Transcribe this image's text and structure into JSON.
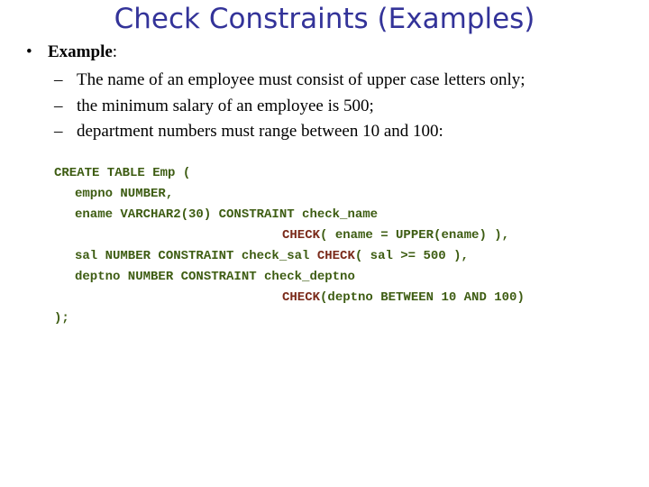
{
  "title": "Check Constraints (Examples)",
  "bullet": {
    "marker": "•",
    "label": "Example",
    "suffix": ":"
  },
  "sub_items": [
    {
      "marker": "–",
      "text": "The name of an employee must consist of upper case letters only;"
    },
    {
      "marker": "–",
      "text": "the minimum salary of an employee is 500;"
    },
    {
      "marker": "–",
      "text": "department numbers must range between 10 and 100:"
    }
  ],
  "code": {
    "line1": "CREATE TABLE Emp (",
    "line2": "empno NUMBER,",
    "line3": "ename VARCHAR2(30) CONSTRAINT check_name",
    "line4_kw": "CHECK",
    "line4_rest": "( ename = UPPER(ename) ),",
    "line5_a": "sal NUMBER CONSTRAINT check_sal ",
    "line5_kw": "CHECK",
    "line5_rest": "( sal >= 500 ),",
    "line6": "deptno NUMBER CONSTRAINT check_deptno",
    "line7_kw": "CHECK",
    "line7_rest": "(deptno BETWEEN 10 AND 100)",
    "line8": ");"
  }
}
